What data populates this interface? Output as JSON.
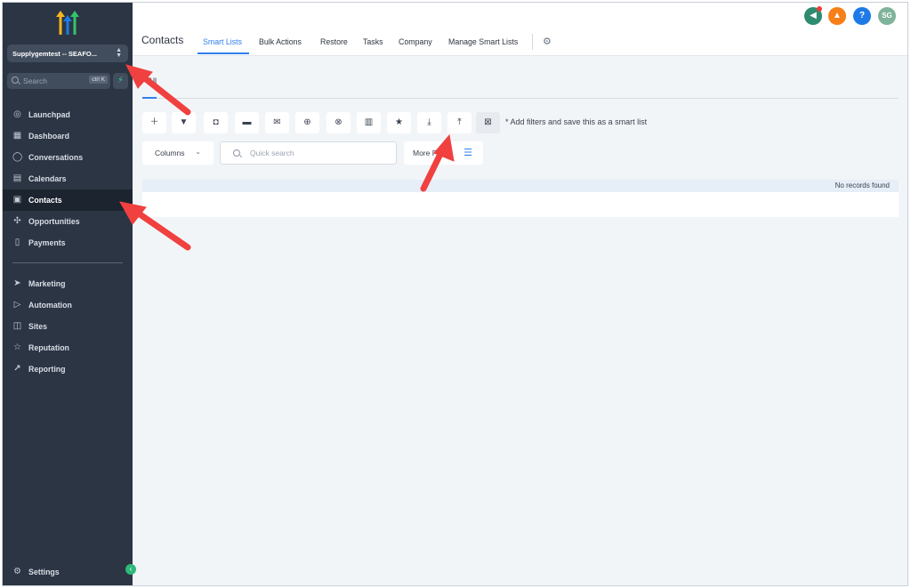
{
  "sidebar": {
    "account": "Supplygemtest -- SEAFO...",
    "search_placeholder": "Search",
    "search_shortcut": "ctrl K",
    "items": [
      {
        "label": "Launchpad"
      },
      {
        "label": "Dashboard"
      },
      {
        "label": "Conversations"
      },
      {
        "label": "Calendars"
      },
      {
        "label": "Contacts"
      },
      {
        "label": "Opportunities"
      },
      {
        "label": "Payments"
      },
      {
        "label": "Marketing"
      },
      {
        "label": "Automation"
      },
      {
        "label": "Sites"
      },
      {
        "label": "Reputation"
      },
      {
        "label": "Reporting"
      }
    ],
    "settings_label": "Settings"
  },
  "header": {
    "title": "Contacts",
    "tabs": [
      {
        "label": "Smart Lists"
      },
      {
        "label": "Bulk Actions"
      },
      {
        "label": "Restore"
      },
      {
        "label": "Tasks"
      },
      {
        "label": "Company"
      },
      {
        "label": "Manage Smart Lists"
      }
    ],
    "avatar_initials": "SG",
    "help_glyph": "?"
  },
  "content": {
    "list_tab": "All",
    "hint": "* Add filters and save this as a smart list",
    "columns_label": "Columns",
    "quick_search_placeholder": "Quick search",
    "more_filters_label": "More Filters",
    "empty_message": "No records found"
  },
  "colors": {
    "sidebar_bg": "#2b3544",
    "accent": "#2f80ed",
    "announce": "#2e8b6f",
    "notify": "#f77f19",
    "help": "#1e7ae6",
    "avatar": "#7fb39a",
    "arrow": "#f0403f"
  }
}
